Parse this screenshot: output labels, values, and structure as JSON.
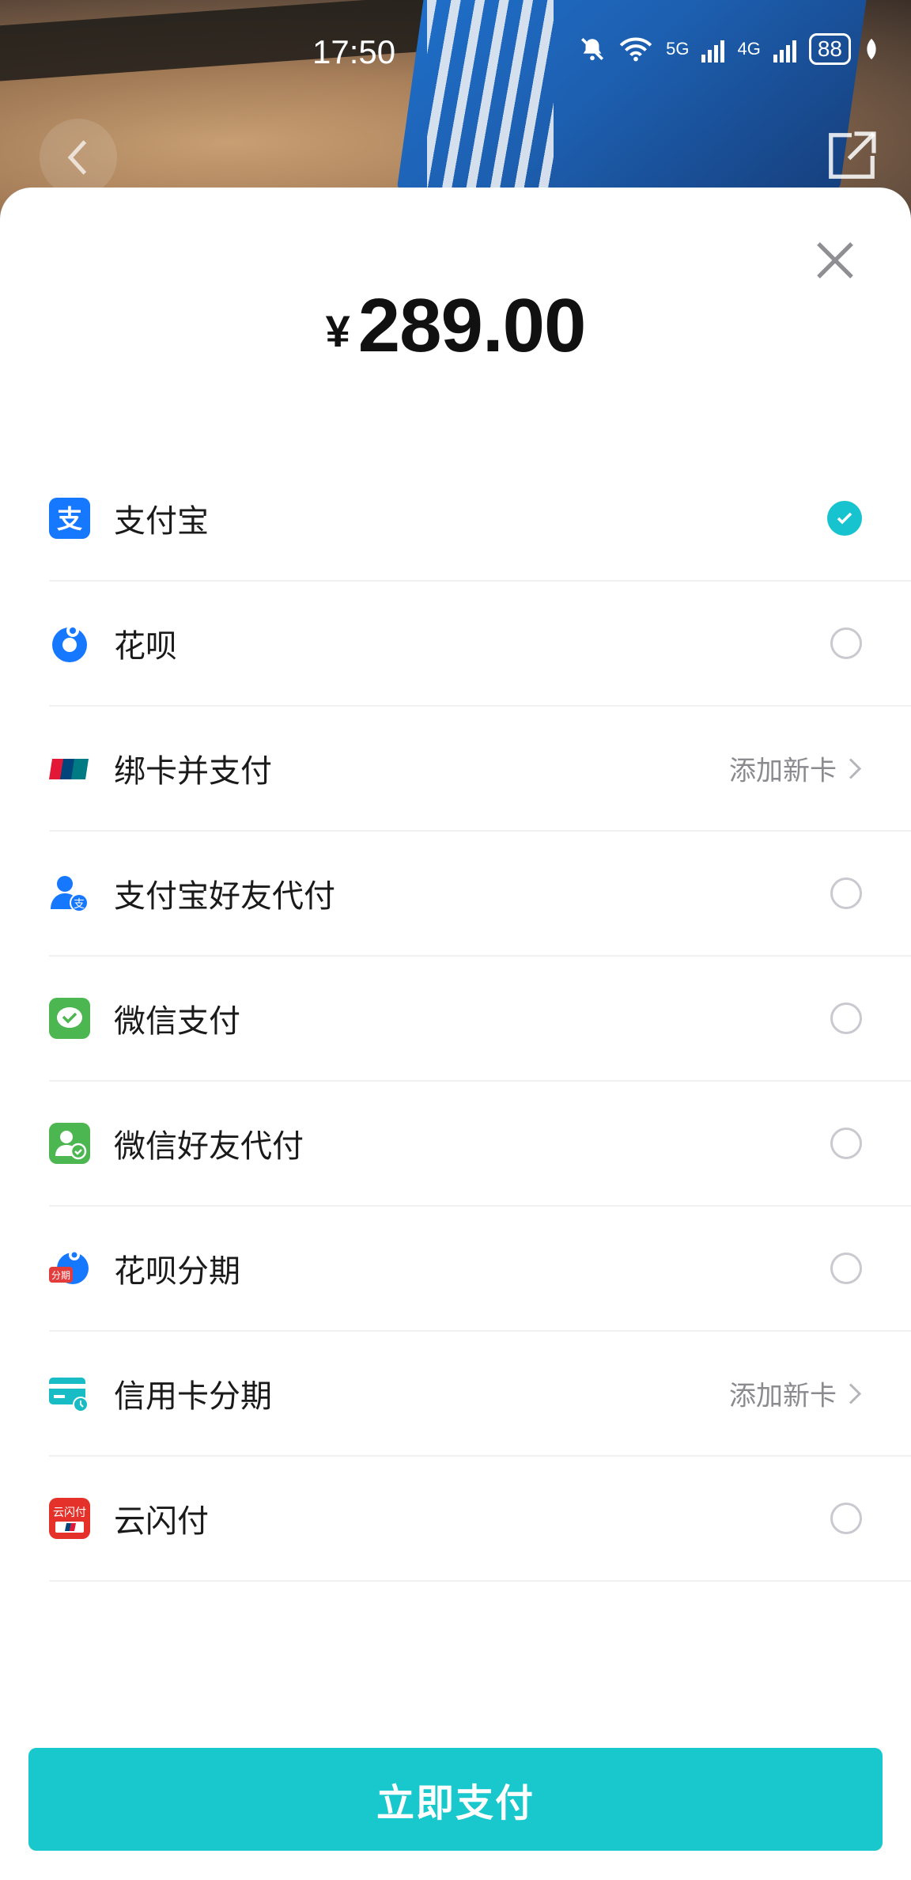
{
  "status_bar": {
    "time": "17:50",
    "network_1": "5G",
    "network_2": "4G",
    "battery": "88"
  },
  "payment": {
    "currency": "¥",
    "amount": "289.00"
  },
  "methods": [
    {
      "label": "支付宝",
      "icon": "alipay-icon",
      "selected": true
    },
    {
      "label": "花呗",
      "icon": "huabei-icon",
      "selected": false
    },
    {
      "label": "绑卡并支付",
      "icon": "unionpay-icon",
      "action": "添加新卡"
    },
    {
      "label": "支付宝好友代付",
      "icon": "alipay-friend-icon",
      "selected": false
    },
    {
      "label": "微信支付",
      "icon": "wechat-pay-icon",
      "selected": false
    },
    {
      "label": "微信好友代付",
      "icon": "wechat-friend-icon",
      "selected": false
    },
    {
      "label": "花呗分期",
      "icon": "huabei-installment-icon",
      "selected": false
    },
    {
      "label": "信用卡分期",
      "icon": "credit-card-installment-icon",
      "action": "添加新卡"
    },
    {
      "label": "云闪付",
      "icon": "yunshanfu-icon",
      "selected": false
    }
  ],
  "pay_button": "立即支付",
  "colors": {
    "accent": "#18c8cc",
    "check": "#17c3ce",
    "alipay_blue": "#1677ff",
    "wechat_green": "#4cb650"
  }
}
